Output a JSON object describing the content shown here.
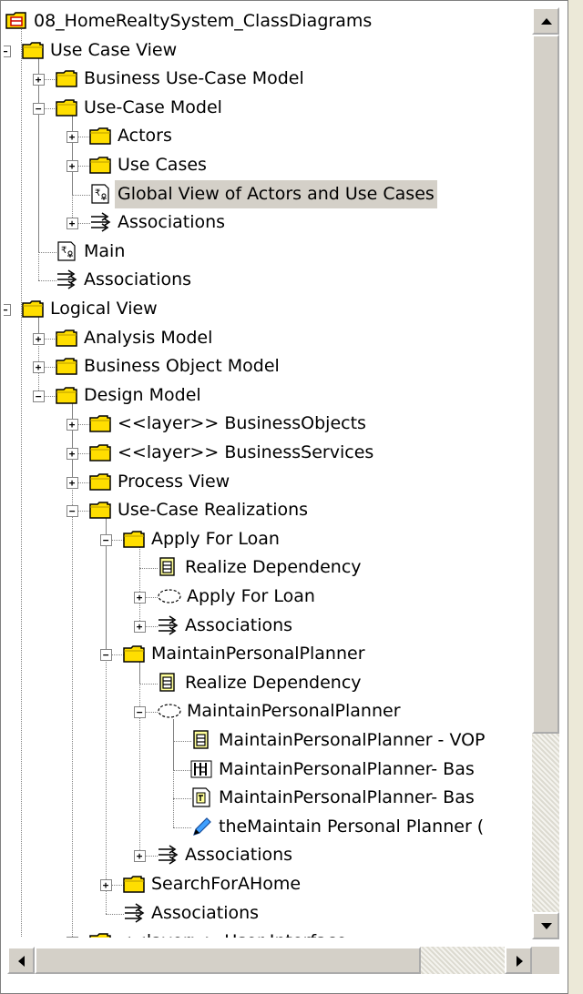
{
  "tree": {
    "items": [
      {
        "label": "08_HomeRealtySystem_ClassDiagrams",
        "level": 0,
        "icon": "model-icon",
        "expander": "none"
      },
      {
        "label": "Use Case View",
        "level": 0,
        "icon": "folder-icon",
        "expander": "minus"
      },
      {
        "label": "Business Use-Case Model",
        "level": 1,
        "icon": "folder-icon",
        "expander": "plus"
      },
      {
        "label": "Use-Case Model",
        "level": 1,
        "icon": "folder-icon",
        "expander": "minus"
      },
      {
        "label": "Actors",
        "level": 2,
        "icon": "folder-icon",
        "expander": "plus"
      },
      {
        "label": "Use Cases",
        "level": 2,
        "icon": "folder-icon",
        "expander": "plus"
      },
      {
        "label": "Global View of Actors and Use Cases",
        "level": 2,
        "icon": "use-case-diagram-icon",
        "expander": "none",
        "selected": true
      },
      {
        "label": "Associations",
        "level": 2,
        "icon": "associations-icon",
        "expander": "plus"
      },
      {
        "label": "Main",
        "level": 1,
        "icon": "use-case-diagram-icon",
        "expander": "none"
      },
      {
        "label": "Associations",
        "level": 1,
        "icon": "associations-icon",
        "expander": "none"
      },
      {
        "label": "Logical View",
        "level": 0,
        "icon": "folder-icon",
        "expander": "minus"
      },
      {
        "label": "Analysis Model",
        "level": 1,
        "icon": "folder-icon",
        "expander": "plus"
      },
      {
        "label": "Business Object Model",
        "level": 1,
        "icon": "folder-icon",
        "expander": "plus"
      },
      {
        "label": "Design Model",
        "level": 1,
        "icon": "folder-icon",
        "expander": "minus"
      },
      {
        "label": "<<layer>> BusinessObjects",
        "level": 2,
        "icon": "folder-icon",
        "expander": "plus"
      },
      {
        "label": "<<layer>> BusinessServices",
        "level": 2,
        "icon": "folder-icon",
        "expander": "plus"
      },
      {
        "label": "Process View",
        "level": 2,
        "icon": "folder-icon",
        "expander": "plus"
      },
      {
        "label": "Use-Case Realizations",
        "level": 2,
        "icon": "folder-icon",
        "expander": "minus"
      },
      {
        "label": "Apply For Loan",
        "level": 3,
        "icon": "folder-icon",
        "expander": "minus"
      },
      {
        "label": "Realize Dependency",
        "level": 4,
        "icon": "class-diagram-icon",
        "expander": "none"
      },
      {
        "label": "Apply For Loan",
        "level": 4,
        "icon": "collaboration-icon",
        "expander": "plus"
      },
      {
        "label": "Associations",
        "level": 4,
        "icon": "associations-icon",
        "expander": "plus"
      },
      {
        "label": "MaintainPersonalPlanner",
        "level": 3,
        "icon": "folder-icon",
        "expander": "minus"
      },
      {
        "label": "Realize Dependency",
        "level": 4,
        "icon": "class-diagram-icon",
        "expander": "none"
      },
      {
        "label": "MaintainPersonalPlanner",
        "level": 4,
        "icon": "collaboration-icon",
        "expander": "minus"
      },
      {
        "label": "MaintainPersonalPlanner - VOP",
        "level": 5,
        "icon": "class-diagram-icon",
        "expander": "none"
      },
      {
        "label": "MaintainPersonalPlanner- Bas",
        "level": 5,
        "icon": "sequence-diagram-icon",
        "expander": "none"
      },
      {
        "label": "MaintainPersonalPlanner- Bas",
        "level": 5,
        "icon": "communication-diagram-icon",
        "expander": "none"
      },
      {
        "label": "theMaintain Personal Planner (",
        "level": 5,
        "icon": "pencil-icon",
        "expander": "none"
      },
      {
        "label": "Associations",
        "level": 4,
        "icon": "associations-icon",
        "expander": "plus"
      },
      {
        "label": "SearchForAHome",
        "level": 3,
        "icon": "folder-icon",
        "expander": "plus"
      },
      {
        "label": "Associations",
        "level": 3,
        "icon": "associations-icon",
        "expander": "none"
      },
      {
        "label": "<<layer>> User Interface",
        "level": 2,
        "icon": "folder-icon",
        "expander": "plus"
      }
    ]
  },
  "colors": {
    "folder": "#ffde00",
    "folder_edge": "#000000",
    "selection": "#d4d0c8",
    "chrome": "#d4d0c8"
  }
}
